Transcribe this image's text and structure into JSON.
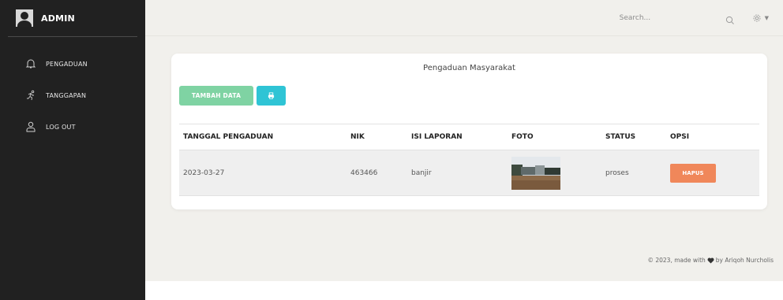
{
  "sidebar": {
    "brand": "ADMIN",
    "items": [
      {
        "label": "PENGADUAN",
        "icon": "bell-icon"
      },
      {
        "label": "TANGGAPAN",
        "icon": "running-icon"
      },
      {
        "label": "LOG OUT",
        "icon": "user-icon"
      }
    ]
  },
  "topbar": {
    "search_placeholder": "Search...",
    "search_icon": "search-icon",
    "settings_icon": "gear-icon"
  },
  "card": {
    "title": "Pengaduan Masyarakat",
    "add_button": "TAMBAH DATA",
    "print_icon": "print-icon"
  },
  "table": {
    "headers": [
      "TANGGAL PENGADUAN",
      "NIK",
      "ISI LAPORAN",
      "FOTO",
      "STATUS",
      "OPSI"
    ],
    "rows": [
      {
        "tanggal": "2023-03-27",
        "nik": "463466",
        "isi": "banjir",
        "status": "proses",
        "opsi": "HAPUS"
      }
    ]
  },
  "footer": {
    "prefix": "© 2023, made with",
    "suffix": "by Ariqoh Nurcholis"
  },
  "colors": {
    "sidebar_bg": "#212121",
    "main_bg": "#f1f0ec",
    "add_button": "#7fd3a3",
    "print_button": "#2fc4d5",
    "delete_button": "#f0875a"
  }
}
